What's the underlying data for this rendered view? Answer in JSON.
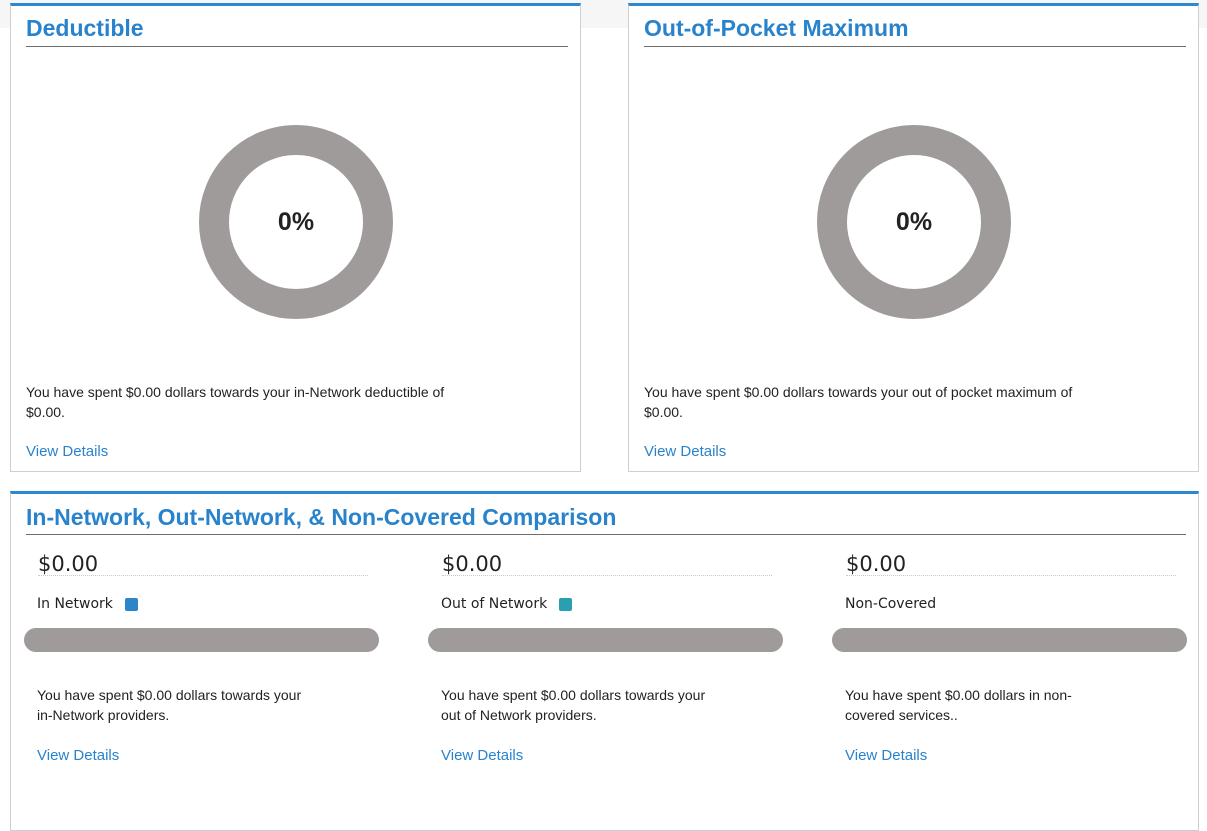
{
  "deductible": {
    "title": "Deductible",
    "percent_label": "0%",
    "percent_value": 0,
    "description_line1": "You have spent $0.00 dollars towards your in-Network deductible of",
    "description_line2": "$0.00.",
    "link": "View Details"
  },
  "out_of_pocket": {
    "title": "Out-of-Pocket Maximum",
    "percent_label": "0%",
    "percent_value": 0,
    "description_line1": "You have spent $0.00 dollars towards your out of pocket maximum of",
    "description_line2": "$0.00.",
    "link": "View Details"
  },
  "comparison": {
    "title": "In-Network, Out-Network, & Non-Covered Comparison",
    "columns": [
      {
        "amount": "$0.00",
        "label": "In Network",
        "swatch_color": "#2d85c9",
        "fill_fraction": 0,
        "description_line1": "You have spent $0.00 dollars towards your",
        "description_line2": "in-Network providers.",
        "link": "View Details"
      },
      {
        "amount": "$0.00",
        "label": "Out of Network",
        "swatch_color": "#2a9fb0",
        "fill_fraction": 0,
        "description_line1": "You have spent $0.00 dollars towards your",
        "description_line2": "out of Network providers.",
        "link": "View Details"
      },
      {
        "amount": "$0.00",
        "label": "Non-Covered",
        "swatch_color": "",
        "fill_fraction": 0,
        "description_line1": "You have spent $0.00 dollars in non-",
        "description_line2": "covered services..",
        "link": "View Details"
      }
    ]
  },
  "colors": {
    "accent": "#2883cc",
    "track_gray": "#9e9b9a"
  }
}
